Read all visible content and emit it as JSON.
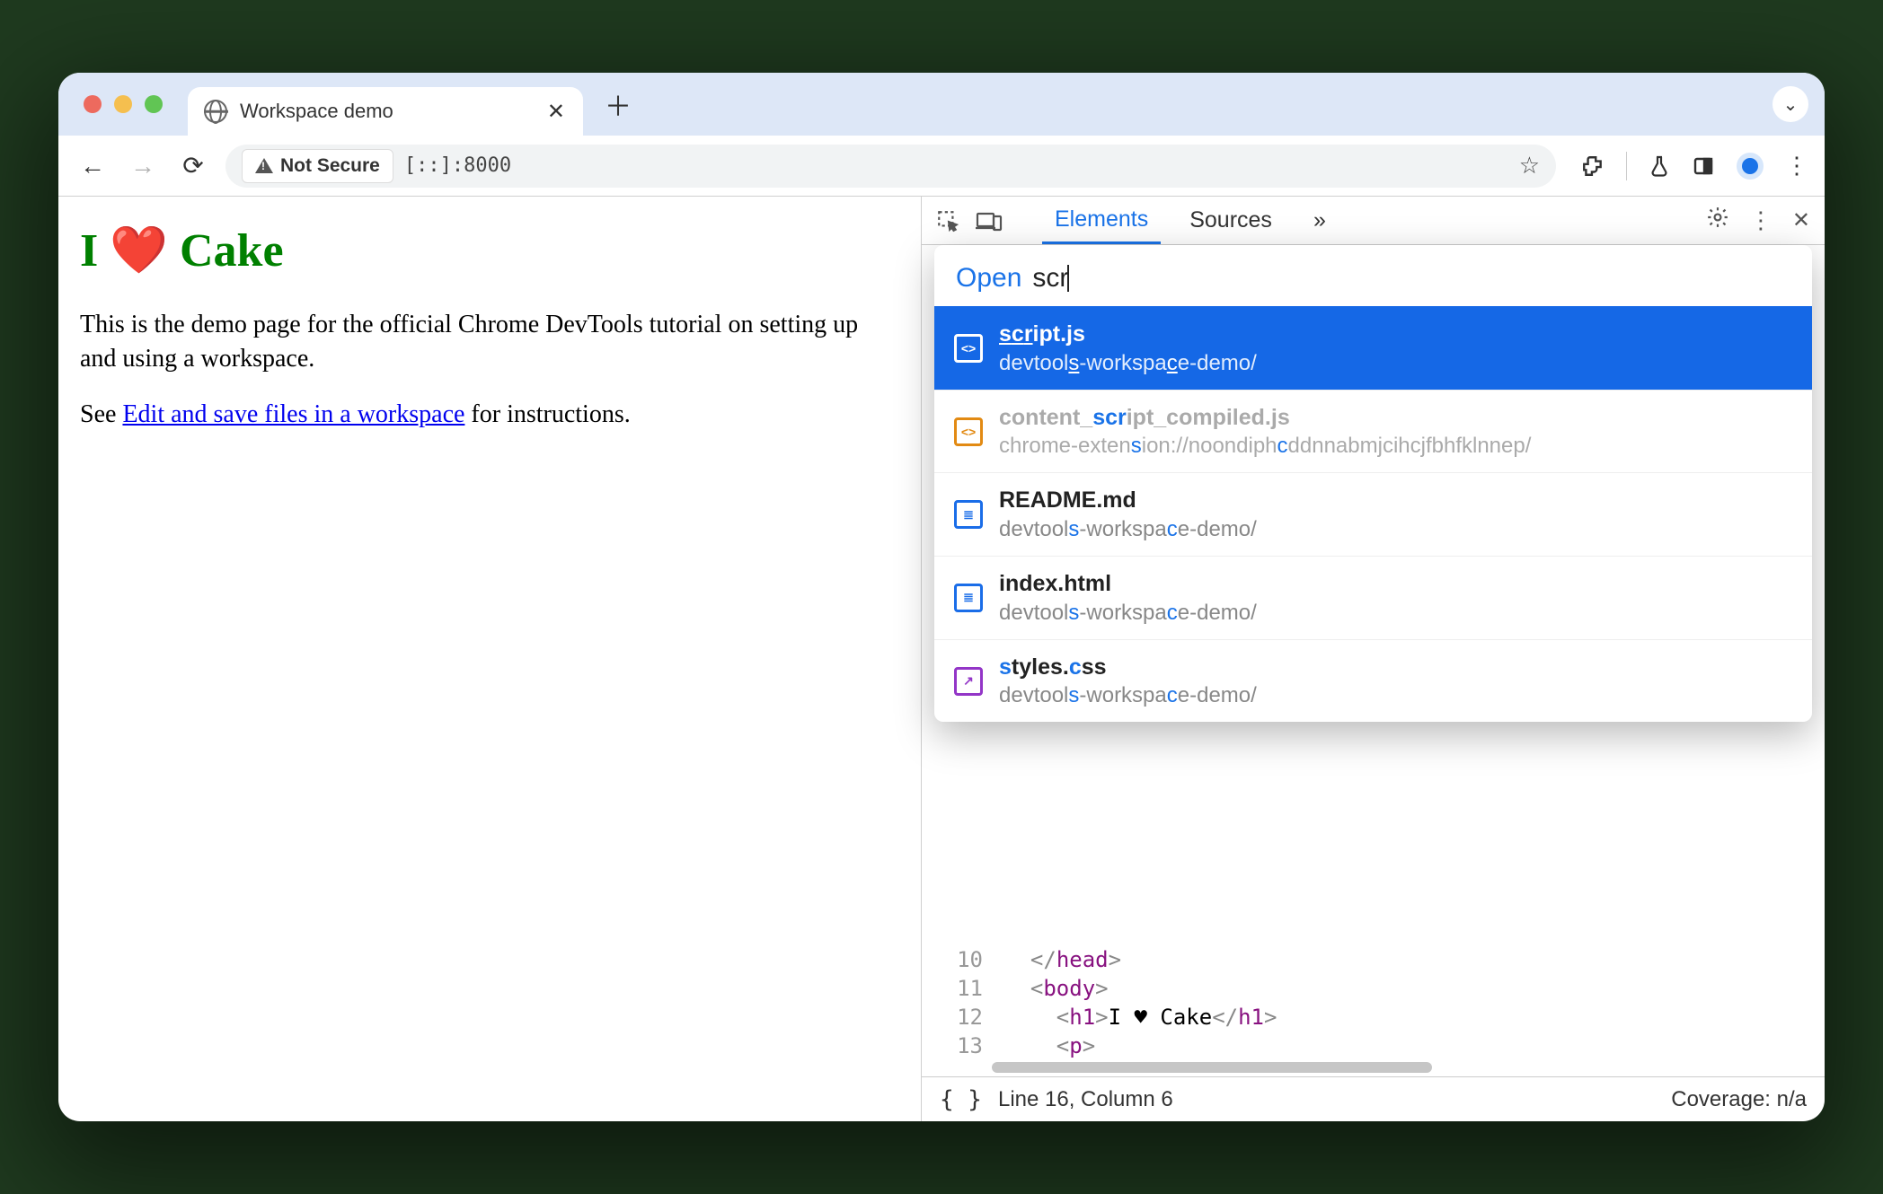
{
  "browser": {
    "tab_title": "Workspace demo",
    "not_secure_label": "Not Secure",
    "url": "[::]:8000"
  },
  "page": {
    "heading_prefix": "I ",
    "heading_emoji": "❤️",
    "heading_suffix": " Cake",
    "para1": "This is the demo page for the official Chrome DevTools tutorial on setting up and using a workspace.",
    "para2_before": "See ",
    "para2_link": "Edit and save files in a workspace",
    "para2_after": " for instructions."
  },
  "devtools": {
    "tabs": {
      "elements": "Elements",
      "sources": "Sources",
      "more": "»"
    }
  },
  "quickopen": {
    "label": "Open",
    "typed": "scr",
    "results": [
      {
        "name": "script.js",
        "path": "devtools-workspace-demo/",
        "icon": "js",
        "selected": true,
        "dim": false
      },
      {
        "name": "content_script_compiled.js",
        "path": "chrome-extension://noondiphcddnnabmjcihcjfbhfklnnep/",
        "icon": "js",
        "selected": false,
        "dim": true
      },
      {
        "name": "README.md",
        "path": "devtools-workspace-demo/",
        "icon": "doc",
        "selected": false,
        "dim": false
      },
      {
        "name": "index.html",
        "path": "devtools-workspace-demo/",
        "icon": "doc",
        "selected": false,
        "dim": false
      },
      {
        "name": "styles.css",
        "path": "devtools-workspace-demo/",
        "icon": "css",
        "selected": false,
        "dim": false
      }
    ]
  },
  "editor": {
    "lines": [
      {
        "no": "10",
        "html": "<span class='tag-ang'>&lt;/</span><span class='tag'>head</span><span class='tag-ang'>&gt;</span>",
        "indent": 1
      },
      {
        "no": "11",
        "html": "<span class='tag-ang'>&lt;</span><span class='tag'>body</span><span class='tag-ang'>&gt;</span>",
        "indent": 1
      },
      {
        "no": "12",
        "html": "<span class='tag-ang'>&lt;</span><span class='tag'>h1</span><span class='tag-ang'>&gt;</span><span class='txt'>I ♥ Cake</span><span class='tag-ang'>&lt;/</span><span class='tag'>h1</span><span class='tag-ang'>&gt;</span>",
        "indent": 2
      },
      {
        "no": "13",
        "html": "<span class='tag-ang'>&lt;</span><span class='tag'>p</span><span class='tag-ang'>&gt;</span>",
        "indent": 2
      }
    ]
  },
  "status": {
    "position": "Line 16, Column 6",
    "coverage": "Coverage: n/a"
  }
}
